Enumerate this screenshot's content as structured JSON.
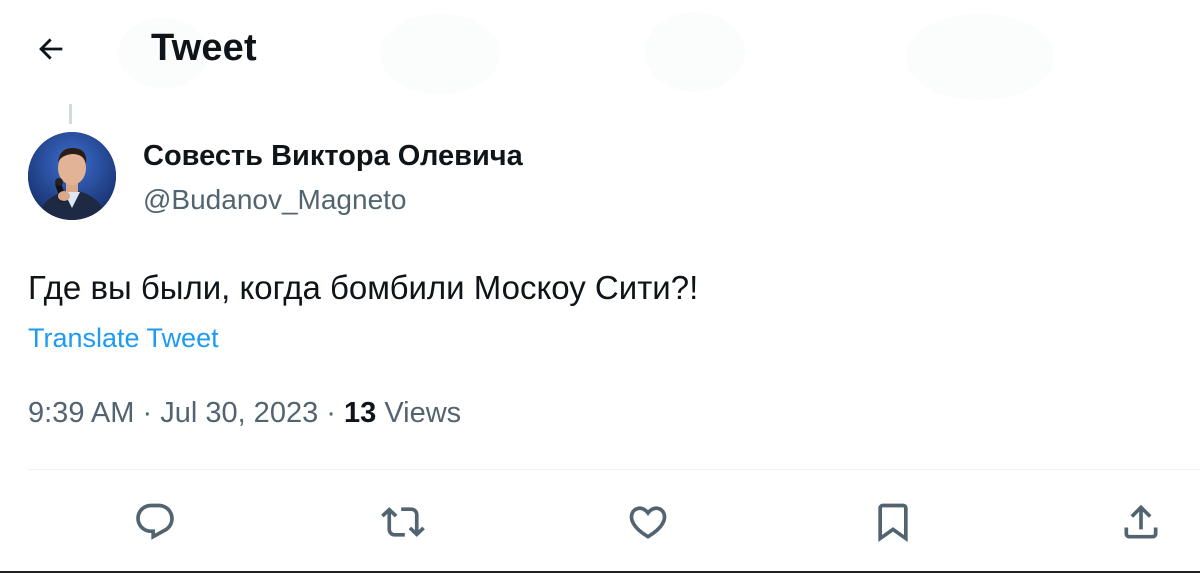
{
  "header": {
    "title": "Tweet",
    "back_icon": "arrow-left-icon"
  },
  "author": {
    "display_name": "Совесть Виктора Олевича",
    "handle": "@Budanov_Magneto",
    "avatar_icon": "user-avatar"
  },
  "tweet": {
    "text": "Где вы были, когда бомбили Москоу Сити?!",
    "translate_label": "Translate Tweet",
    "time": "9:39 AM",
    "separator": " · ",
    "date": "Jul 30, 2023",
    "views_count": "13",
    "views_label": "Views"
  },
  "actions": [
    {
      "name": "reply",
      "icon": "reply-icon"
    },
    {
      "name": "retweet",
      "icon": "retweet-icon"
    },
    {
      "name": "like",
      "icon": "heart-icon"
    },
    {
      "name": "bookmark",
      "icon": "bookmark-icon"
    },
    {
      "name": "share",
      "icon": "share-icon"
    }
  ],
  "colors": {
    "text_primary": "#0f1419",
    "text_secondary": "#536471",
    "link": "#1d9bf0",
    "divider": "#eff3f4"
  }
}
